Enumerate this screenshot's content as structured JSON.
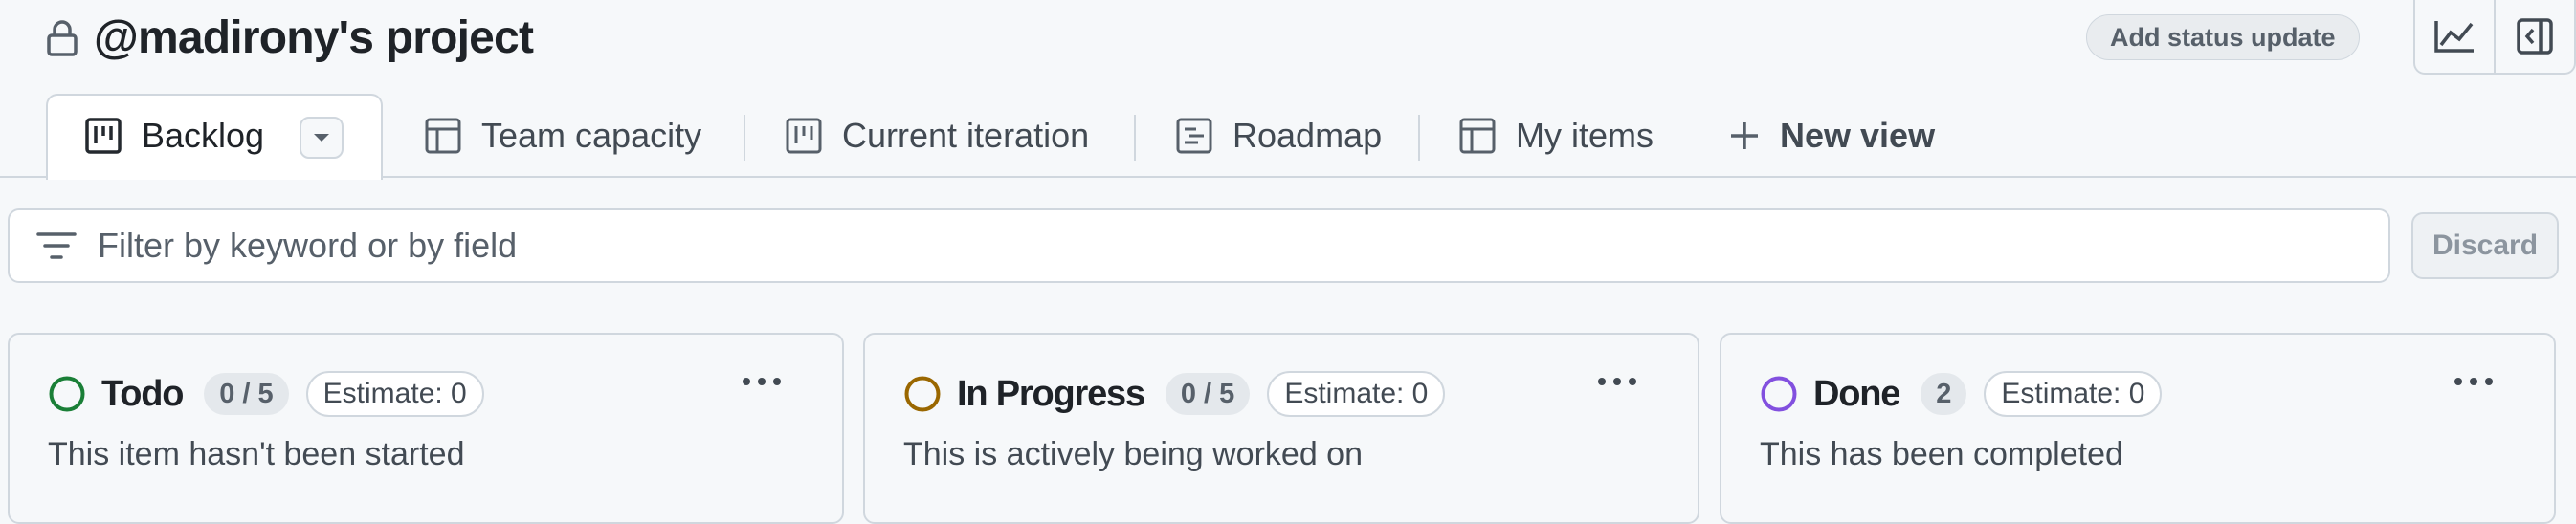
{
  "project": {
    "title": "@madirony's project",
    "status_button": "Add status update"
  },
  "header_buttons": [
    {
      "icon": "graph-icon"
    },
    {
      "icon": "sidebar-toggle-icon"
    }
  ],
  "tabs": [
    {
      "label": "Backlog",
      "icon": "board-icon",
      "active": true
    },
    {
      "label": "Team capacity",
      "icon": "table-icon"
    },
    {
      "label": "Current iteration",
      "icon": "board-icon"
    },
    {
      "label": "Roadmap",
      "icon": "roadmap-icon"
    },
    {
      "label": "My items",
      "icon": "table-icon"
    },
    {
      "label": "New view",
      "icon": "plus-icon"
    }
  ],
  "filter": {
    "placeholder": "Filter by keyword or by field",
    "value": "",
    "discard_label": "Discard"
  },
  "columns": [
    {
      "name": "Todo",
      "count": "0 / 5",
      "estimate": "Estimate: 0",
      "description": "This item hasn't been started",
      "color": "#1a7f37"
    },
    {
      "name": "In Progress",
      "count": "0 / 5",
      "estimate": "Estimate: 0",
      "description": "This is actively being worked on",
      "color": "#9a6700"
    },
    {
      "name": "Done",
      "count": "2",
      "estimate": "Estimate: 0",
      "description": "This has been completed",
      "color": "#8250df"
    }
  ],
  "colors": {
    "border": "#d0d7de",
    "muted_text": "#57606a",
    "background": "#f6f8fa"
  }
}
